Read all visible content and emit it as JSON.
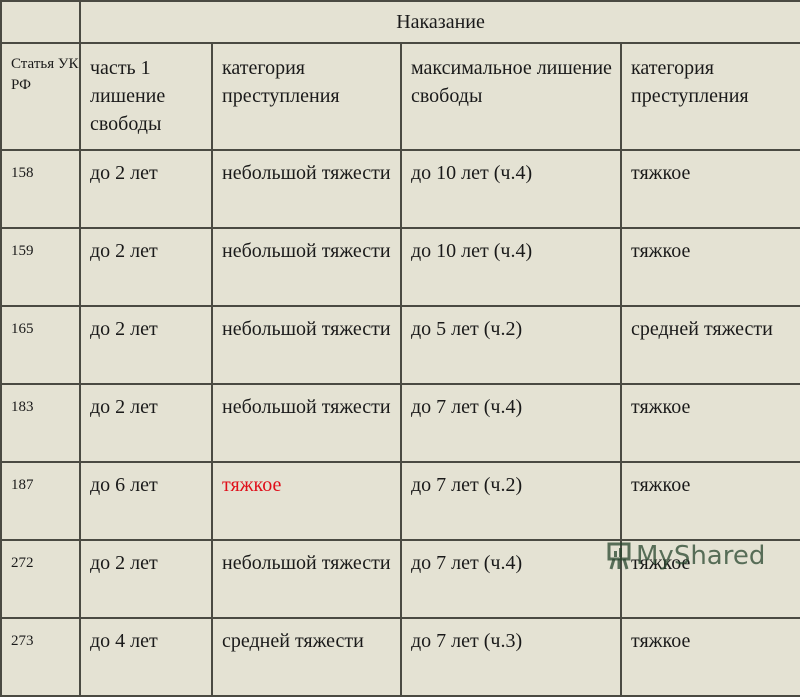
{
  "table": {
    "title_row": {
      "empty": "",
      "title": "Наказание"
    },
    "headers": [
      "Статья УК РФ",
      "часть 1 лишение свободы",
      "категория преступления",
      "максимальное лишение свободы",
      "категория преступления"
    ],
    "rows": [
      {
        "article": "158",
        "part1": "до 2 лет",
        "category1": "небольшой тяжести",
        "max": "до 10 лет (ч.4)",
        "category2": "тяжкое"
      },
      {
        "article": "159",
        "part1": "до 2 лет",
        "category1": "небольшой тяжести",
        "max": "до 10 лет (ч.4)",
        "category2": "тяжкое"
      },
      {
        "article": "165",
        "part1": "до 2 лет",
        "category1": "небольшой тяжести",
        "max": "до 5 лет (ч.2)",
        "category2": "средней тяжести"
      },
      {
        "article": "183",
        "part1": "до 2 лет",
        "category1": "небольшой тяжести",
        "max": "до 7 лет (ч.4)",
        "category2": "тяжкое"
      },
      {
        "article": "187",
        "part1": "до 6 лет",
        "category1": "тяжкое",
        "max": "до 7 лет (ч.2)",
        "category2": "тяжкое",
        "category1_highlight": true
      },
      {
        "article": "272",
        "part1": "до 2 лет",
        "category1": "небольшой тяжести",
        "max": "до 7 лет (ч.4)",
        "category2": "тяжкое"
      },
      {
        "article": "273",
        "part1": "до 4 лет",
        "category1": "средней тяжести",
        "max": "до 7 лет (ч.3)",
        "category2": "тяжкое"
      }
    ]
  },
  "colors": {
    "background": "#e4e2d3",
    "highlight": "#e00f1a",
    "border": "#4a4a42"
  },
  "watermark": {
    "icon": "presentation-board-icon",
    "text": "MyShared"
  }
}
